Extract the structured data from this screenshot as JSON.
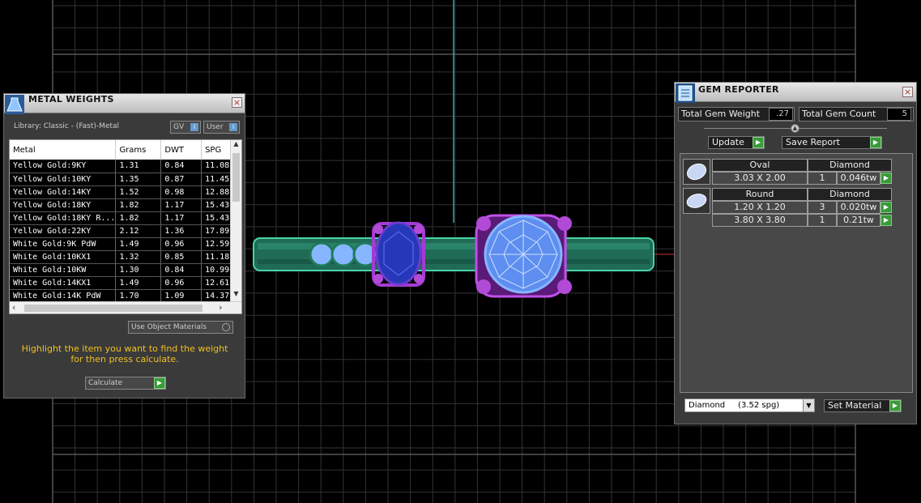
{
  "metal_weights": {
    "title": "METAL WEIGHTS",
    "library_label": "Library: Classic - (Fast)-Metal",
    "gv_button": "GV",
    "user_button": "User",
    "columns": [
      "Metal",
      "Grams",
      "DWT",
      "SPG"
    ],
    "rows": [
      [
        "Yellow Gold:9KY",
        "1.31",
        "0.84",
        "11.08"
      ],
      [
        "Yellow Gold:10KY",
        "1.35",
        "0.87",
        "11.45"
      ],
      [
        "Yellow Gold:14KY",
        "1.52",
        "0.98",
        "12.88"
      ],
      [
        "Yellow Gold:18KY",
        "1.82",
        "1.17",
        "15.43"
      ],
      [
        "Yellow Gold:18KY R...",
        "1.82",
        "1.17",
        "15.43"
      ],
      [
        "Yellow Gold:22KY",
        "2.12",
        "1.36",
        "17.89"
      ],
      [
        "White Gold:9K PdW",
        "1.49",
        "0.96",
        "12.59"
      ],
      [
        "White Gold:10KX1",
        "1.32",
        "0.85",
        "11.18"
      ],
      [
        "White Gold:10KW",
        "1.30",
        "0.84",
        "10.99"
      ],
      [
        "White Gold:14KX1",
        "1.49",
        "0.96",
        "12.61"
      ],
      [
        "White Gold:14K PdW",
        "1.70",
        "1.09",
        "14.37"
      ]
    ],
    "use_object_materials": "Use Object Materials",
    "instructions": "Highlight the item you want to find the weight for then press calculate.",
    "calculate_button": "Calculate"
  },
  "gem_reporter": {
    "title": "GEM REPORTER",
    "total_weight_label": "Total Gem Weight",
    "total_weight_value": ".27",
    "total_count_label": "Total Gem Count",
    "total_count_value": "5",
    "update_button": "Update",
    "save_button": "Save Report",
    "groups": [
      {
        "shape": "Oval",
        "material": "Diamond",
        "rows": [
          [
            "3.03 X 2.00",
            "1",
            "0.046tw"
          ]
        ]
      },
      {
        "shape": "Round",
        "material": "Diamond",
        "rows": [
          [
            "1.20 X 1.20",
            "3",
            "0.020tw"
          ],
          [
            "3.80 X 3.80",
            "1",
            "0.21tw"
          ]
        ]
      }
    ],
    "material_select": "Diamond     (3.52 spg)",
    "set_material_button": "Set Material"
  }
}
